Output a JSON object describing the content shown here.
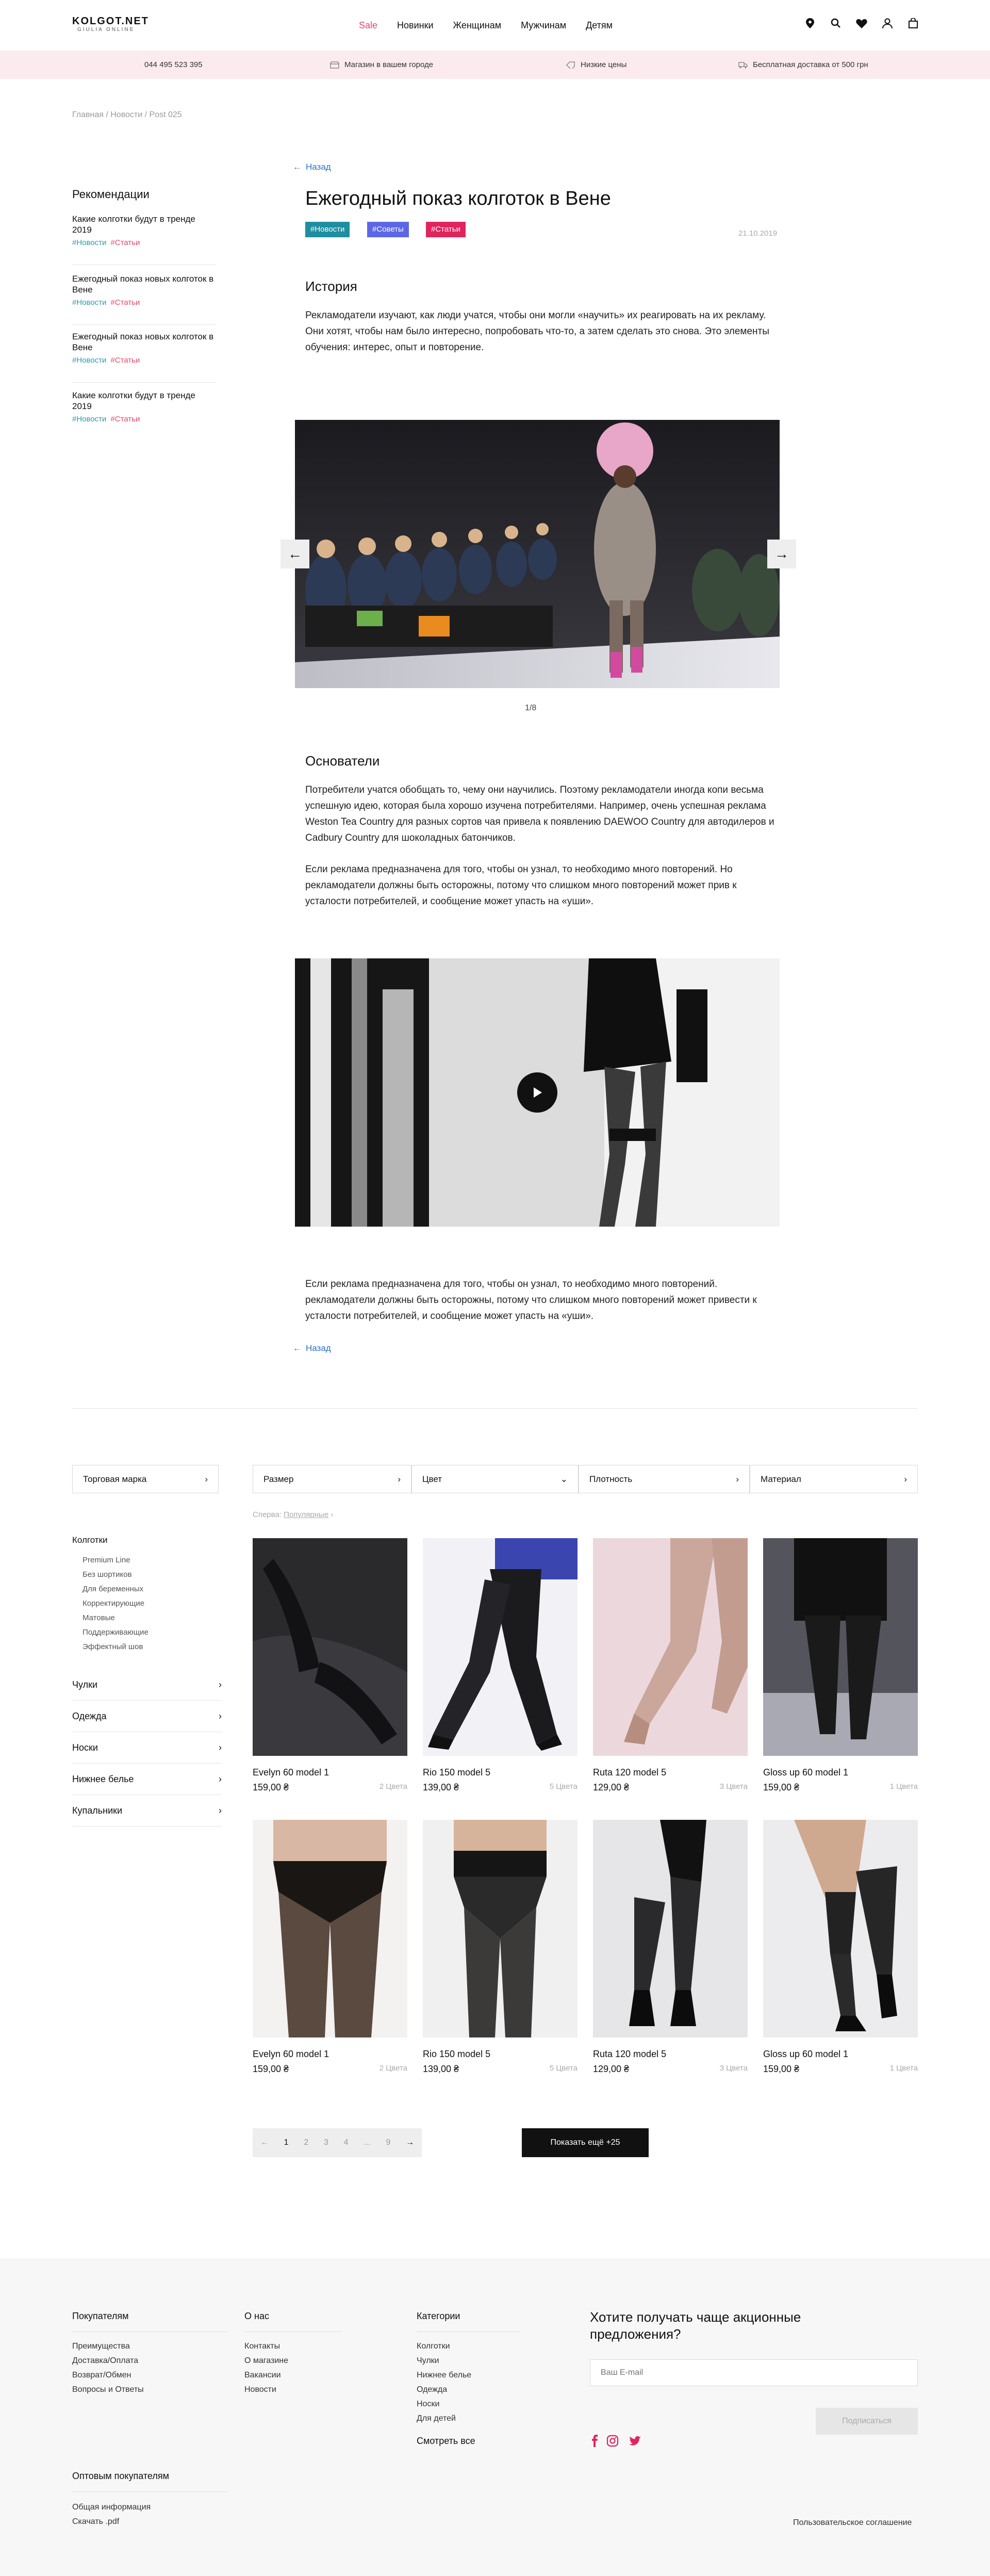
{
  "header": {
    "logo": "KOLGOT.NET",
    "logo_sub": "GIULIA ONLINE",
    "nav": [
      "Sale",
      "Новинки",
      "Женщинам",
      "Мужчинам",
      "Детям"
    ]
  },
  "topbar": {
    "phone": "044 495 523 395",
    "stores": "Магазин в вашем городе",
    "prices": "Низкие цены",
    "delivery": "Бесплатная доставка от 500 грн"
  },
  "breadcrumb": "Главная / Новости / Post 025",
  "sidebar": {
    "title": "Рекомендации",
    "items": [
      {
        "title": "Какие колготки будут в тренде 2019",
        "tag1": "#Новости",
        "tag2": "#Статьи"
      },
      {
        "title": "Ежегодный показ новых колготок в Вене",
        "tag1": "#Новости",
        "tag2": "#Статьи"
      },
      {
        "title": "Ежегодный показ новых колготок в Вене",
        "tag1": "#Новости",
        "tag2": "#Статьи"
      },
      {
        "title": "Какие колготки будут в тренде 2019",
        "tag1": "#Новости",
        "tag2": "#Статьи"
      }
    ]
  },
  "article": {
    "back": "Назад",
    "title": "Ежегодный показ колготок в Вене",
    "badges": [
      "#Новости",
      "#Советы",
      "#Статьи"
    ],
    "badge_colors": [
      "#1e8ea0",
      "#5b67e6",
      "#e0245e"
    ],
    "date": "21.10.2019",
    "h_history": "История",
    "p_history": "Рекламодатели изучают, как люди учатся, чтобы они могли «научить» их реагировать на их рекламу. Они хотят, чтобы нам было интересно, попробовать что-то, а затем сделать это снова. Это элементы обучения: интерес, опыт и повторение.",
    "slider_counter": "1/8",
    "h_basics": "Основатели",
    "p_basics1": "Потребители учатся обобщать то, чему они научились. Поэтому рекламодатели иногда копи весьма успешную идею, которая была хорошо изучена потребителями. Например, очень успешная реклама Weston Tea Country для разных сортов чая привела к появлению DAEWOO Country для автодилеров и Cadbury Country для шоколадных батончиков.",
    "p_basics2": "Если реклама предназначена для того, чтобы он узнал, то необходимо много повторений. Но рекламодатели должны быть осторожны, потому что слишком много повторений может прив к усталости потребителей, и сообщение может упасть на «уши».",
    "p_final": "Если реклама предназначена для того, чтобы он узнал, то необходимо много повторений. рекламодатели должны быть осторожны, потому что слишком много повторений может привести к усталости потребителей, и сообщение может упасть на «уши».",
    "back2": "Назад"
  },
  "filters": {
    "brand": "Торговая марка",
    "size": "Размер",
    "color": "Цвет",
    "density": "Плотность",
    "material": "Материал"
  },
  "sort": {
    "label": "Сперва:",
    "value": "Популярные"
  },
  "categories": {
    "head": "Колготки",
    "subs": [
      "Premium Line",
      "Без шортиков",
      "Для беременных",
      "Корректирующие",
      "Матовые",
      "Поддерживающие",
      "Эффектный шов"
    ],
    "rows": [
      "Чулки",
      "Одежда",
      "Носки",
      "Нижнее белье",
      "Купальники"
    ]
  },
  "products": [
    {
      "name": "Evelyn 60 model 1",
      "price": "159,00 ₴",
      "colors": "2 Цвета"
    },
    {
      "name": "Rio 150 model 5",
      "price": "139,00 ₴",
      "colors": "5 Цвета"
    },
    {
      "name": "Ruta 120 model 5",
      "price": "129,00 ₴",
      "colors": "3 Цвета"
    },
    {
      "name": "Gloss up 60 model 1",
      "price": "159,00 ₴",
      "colors": "1 Цвета"
    },
    {
      "name": "Evelyn 60 model 1",
      "price": "159,00 ₴",
      "colors": "2 Цвета"
    },
    {
      "name": "Rio 150 model 5",
      "price": "139,00 ₴",
      "colors": "5 Цвета"
    },
    {
      "name": "Ruta 120 model 5",
      "price": "129,00 ₴",
      "colors": "3 Цвета"
    },
    {
      "name": "Gloss up 60 model 1",
      "price": "159,00 ₴",
      "colors": "1 Цвета"
    }
  ],
  "pager": {
    "prev": "←",
    "pages": [
      "1",
      "2",
      "3",
      "4",
      "...",
      "9"
    ],
    "next": "→",
    "show_more": "Показать ещё +25"
  },
  "footer": {
    "buyers_title": "Покупателям",
    "buyers": [
      "Преимущества",
      "Доставка/Оплата",
      "Возврат/Обмен",
      "Вопросы и Ответы"
    ],
    "about_title": "О нас",
    "about": [
      "Контакты",
      "О магазине",
      "Вакансии",
      "Новости"
    ],
    "cats_title": "Категории",
    "cats": [
      "Колготки",
      "Чулки",
      "Нижнее белье",
      "Одежда",
      "Носки",
      "Для детей"
    ],
    "see_all": "Смотреть все",
    "subscribe_title": "Хотите получать чаще акционные предложения?",
    "email_placeholder": "Ваш E-mail",
    "subscribe_btn": "Подписаться",
    "wholesale_title": "Оптовым покупателям",
    "wholesale": [
      "Общая информация",
      "Скачать .pdf"
    ],
    "legal": "Пользовательское соглашение"
  }
}
